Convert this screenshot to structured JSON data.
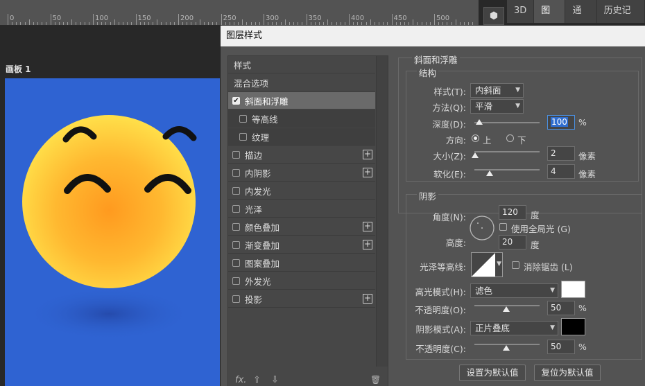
{
  "ruler": {
    "labels": [
      "0",
      "50",
      "100",
      "150",
      "200",
      "250",
      "300",
      "350",
      "400",
      "450",
      "500"
    ]
  },
  "right_tabs": [
    {
      "label": "3D",
      "active": false
    },
    {
      "label": "图层",
      "active": true
    },
    {
      "label": "通道",
      "active": false
    },
    {
      "label": "历史记录",
      "active": false
    }
  ],
  "artboard": {
    "label": "画板 1"
  },
  "dialog": {
    "title": "图层样式",
    "left_panel": {
      "items": [
        {
          "label": "样式",
          "kind": "header"
        },
        {
          "label": "混合选项",
          "kind": "header"
        },
        {
          "label": "斜面和浮雕",
          "checked": true,
          "selected": true,
          "plus": false
        },
        {
          "label": "等高线",
          "checked": false,
          "sub": true,
          "plus": false
        },
        {
          "label": "纹理",
          "checked": false,
          "sub": true,
          "plus": false
        },
        {
          "label": "描边",
          "checked": false,
          "plus": true
        },
        {
          "label": "内阴影",
          "checked": false,
          "plus": true
        },
        {
          "label": "内发光",
          "checked": false,
          "plus": false
        },
        {
          "label": "光泽",
          "checked": false,
          "plus": false
        },
        {
          "label": "颜色叠加",
          "checked": false,
          "plus": true
        },
        {
          "label": "渐变叠加",
          "checked": false,
          "plus": true
        },
        {
          "label": "图案叠加",
          "checked": false,
          "plus": false
        },
        {
          "label": "外发光",
          "checked": false,
          "plus": false
        },
        {
          "label": "投影",
          "checked": false,
          "plus": true
        }
      ],
      "footer_fx": "fx.",
      "footer_up": "⇧",
      "footer_down": "⇩",
      "footer_trash": "🗑"
    },
    "bevel": {
      "section_title": "斜面和浮雕",
      "structure_title": "结构",
      "style_label": "样式(T):",
      "style_value": "内斜面",
      "method_label": "方法(Q):",
      "method_value": "平滑",
      "depth_label": "深度(D):",
      "depth_value": "100",
      "depth_unit": "%",
      "direction_label": "方向:",
      "direction_up": "上",
      "direction_down": "下",
      "direction_selected": "上",
      "size_label": "大小(Z):",
      "size_value": "2",
      "size_unit": "像素",
      "soften_label": "软化(E):",
      "soften_value": "4",
      "soften_unit": "像素"
    },
    "shading": {
      "title": "阴影",
      "angle_label": "角度(N):",
      "angle_value": "120",
      "angle_unit": "度",
      "global_light_label": "使用全局光 (G)",
      "global_light_checked": false,
      "altitude_label": "高度:",
      "altitude_value": "20",
      "altitude_unit": "度",
      "gloss_contour_label": "光泽等高线:",
      "anti_alias_label": "消除锯齿 (L)",
      "anti_alias_checked": false,
      "highlight_mode_label": "高光模式(H):",
      "highlight_mode_value": "滤色",
      "highlight_color": "#ffffff",
      "highlight_opacity_label": "不透明度(O):",
      "highlight_opacity_value": "50",
      "highlight_opacity_unit": "%",
      "shadow_mode_label": "阴影模式(A):",
      "shadow_mode_value": "正片叠底",
      "shadow_color": "#000000",
      "shadow_opacity_label": "不透明度(C):",
      "shadow_opacity_value": "50",
      "shadow_opacity_unit": "%"
    },
    "buttons": {
      "make_default": "设置为默认值",
      "reset_default": "复位为默认值"
    }
  },
  "colors": {
    "canvas_bg": "#2f63d2",
    "emoji_yellow": "#ffd23f",
    "emoji_orange": "#ff9a1f"
  }
}
